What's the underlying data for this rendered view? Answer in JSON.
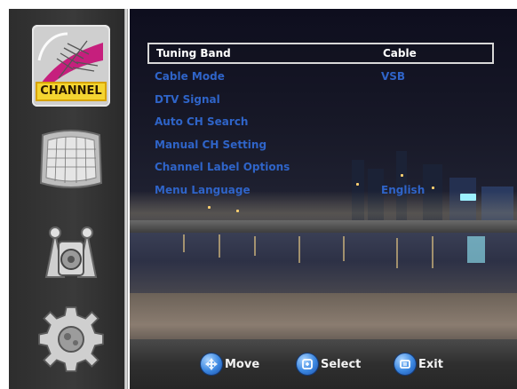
{
  "sidebar": {
    "items": [
      {
        "name": "channel",
        "label": "CHANNEL",
        "selected": true
      },
      {
        "name": "picture",
        "selected": false
      },
      {
        "name": "audio",
        "selected": false
      },
      {
        "name": "setup",
        "selected": false
      }
    ]
  },
  "menu": {
    "items": [
      {
        "label": "Tuning Band",
        "value": "Cable",
        "selected": true
      },
      {
        "label": "Cable Mode",
        "value": "VSB",
        "selected": false
      },
      {
        "label": "DTV Signal",
        "value": "",
        "selected": false
      },
      {
        "label": "Auto CH Search",
        "value": "",
        "selected": false
      },
      {
        "label": "Manual CH Setting",
        "value": "",
        "selected": false
      },
      {
        "label": "Channel Label Options",
        "value": "",
        "selected": false
      },
      {
        "label": "Menu Language",
        "value": "English",
        "selected": false
      }
    ]
  },
  "bottom_bar": {
    "move_label": "Move",
    "select_label": "Select",
    "exit_label": "Exit"
  },
  "colors": {
    "selected_text": "#ffffff",
    "menu_text": "#2f64c8",
    "channel_badge": "#f4d531"
  }
}
